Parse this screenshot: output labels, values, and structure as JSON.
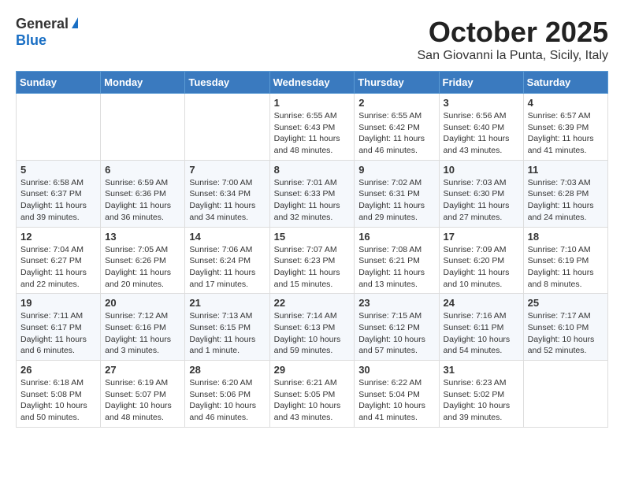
{
  "logo": {
    "general": "General",
    "blue": "Blue"
  },
  "title": "October 2025",
  "location": "San Giovanni la Punta, Sicily, Italy",
  "days_header": [
    "Sunday",
    "Monday",
    "Tuesday",
    "Wednesday",
    "Thursday",
    "Friday",
    "Saturday"
  ],
  "weeks": [
    [
      {
        "day": "",
        "content": ""
      },
      {
        "day": "",
        "content": ""
      },
      {
        "day": "",
        "content": ""
      },
      {
        "day": "1",
        "content": "Sunrise: 6:55 AM\nSunset: 6:43 PM\nDaylight: 11 hours\nand 48 minutes."
      },
      {
        "day": "2",
        "content": "Sunrise: 6:55 AM\nSunset: 6:42 PM\nDaylight: 11 hours\nand 46 minutes."
      },
      {
        "day": "3",
        "content": "Sunrise: 6:56 AM\nSunset: 6:40 PM\nDaylight: 11 hours\nand 43 minutes."
      },
      {
        "day": "4",
        "content": "Sunrise: 6:57 AM\nSunset: 6:39 PM\nDaylight: 11 hours\nand 41 minutes."
      }
    ],
    [
      {
        "day": "5",
        "content": "Sunrise: 6:58 AM\nSunset: 6:37 PM\nDaylight: 11 hours\nand 39 minutes."
      },
      {
        "day": "6",
        "content": "Sunrise: 6:59 AM\nSunset: 6:36 PM\nDaylight: 11 hours\nand 36 minutes."
      },
      {
        "day": "7",
        "content": "Sunrise: 7:00 AM\nSunset: 6:34 PM\nDaylight: 11 hours\nand 34 minutes."
      },
      {
        "day": "8",
        "content": "Sunrise: 7:01 AM\nSunset: 6:33 PM\nDaylight: 11 hours\nand 32 minutes."
      },
      {
        "day": "9",
        "content": "Sunrise: 7:02 AM\nSunset: 6:31 PM\nDaylight: 11 hours\nand 29 minutes."
      },
      {
        "day": "10",
        "content": "Sunrise: 7:03 AM\nSunset: 6:30 PM\nDaylight: 11 hours\nand 27 minutes."
      },
      {
        "day": "11",
        "content": "Sunrise: 7:03 AM\nSunset: 6:28 PM\nDaylight: 11 hours\nand 24 minutes."
      }
    ],
    [
      {
        "day": "12",
        "content": "Sunrise: 7:04 AM\nSunset: 6:27 PM\nDaylight: 11 hours\nand 22 minutes."
      },
      {
        "day": "13",
        "content": "Sunrise: 7:05 AM\nSunset: 6:26 PM\nDaylight: 11 hours\nand 20 minutes."
      },
      {
        "day": "14",
        "content": "Sunrise: 7:06 AM\nSunset: 6:24 PM\nDaylight: 11 hours\nand 17 minutes."
      },
      {
        "day": "15",
        "content": "Sunrise: 7:07 AM\nSunset: 6:23 PM\nDaylight: 11 hours\nand 15 minutes."
      },
      {
        "day": "16",
        "content": "Sunrise: 7:08 AM\nSunset: 6:21 PM\nDaylight: 11 hours\nand 13 minutes."
      },
      {
        "day": "17",
        "content": "Sunrise: 7:09 AM\nSunset: 6:20 PM\nDaylight: 11 hours\nand 10 minutes."
      },
      {
        "day": "18",
        "content": "Sunrise: 7:10 AM\nSunset: 6:19 PM\nDaylight: 11 hours\nand 8 minutes."
      }
    ],
    [
      {
        "day": "19",
        "content": "Sunrise: 7:11 AM\nSunset: 6:17 PM\nDaylight: 11 hours\nand 6 minutes."
      },
      {
        "day": "20",
        "content": "Sunrise: 7:12 AM\nSunset: 6:16 PM\nDaylight: 11 hours\nand 3 minutes."
      },
      {
        "day": "21",
        "content": "Sunrise: 7:13 AM\nSunset: 6:15 PM\nDaylight: 11 hours\nand 1 minute."
      },
      {
        "day": "22",
        "content": "Sunrise: 7:14 AM\nSunset: 6:13 PM\nDaylight: 10 hours\nand 59 minutes."
      },
      {
        "day": "23",
        "content": "Sunrise: 7:15 AM\nSunset: 6:12 PM\nDaylight: 10 hours\nand 57 minutes."
      },
      {
        "day": "24",
        "content": "Sunrise: 7:16 AM\nSunset: 6:11 PM\nDaylight: 10 hours\nand 54 minutes."
      },
      {
        "day": "25",
        "content": "Sunrise: 7:17 AM\nSunset: 6:10 PM\nDaylight: 10 hours\nand 52 minutes."
      }
    ],
    [
      {
        "day": "26",
        "content": "Sunrise: 6:18 AM\nSunset: 5:08 PM\nDaylight: 10 hours\nand 50 minutes."
      },
      {
        "day": "27",
        "content": "Sunrise: 6:19 AM\nSunset: 5:07 PM\nDaylight: 10 hours\nand 48 minutes."
      },
      {
        "day": "28",
        "content": "Sunrise: 6:20 AM\nSunset: 5:06 PM\nDaylight: 10 hours\nand 46 minutes."
      },
      {
        "day": "29",
        "content": "Sunrise: 6:21 AM\nSunset: 5:05 PM\nDaylight: 10 hours\nand 43 minutes."
      },
      {
        "day": "30",
        "content": "Sunrise: 6:22 AM\nSunset: 5:04 PM\nDaylight: 10 hours\nand 41 minutes."
      },
      {
        "day": "31",
        "content": "Sunrise: 6:23 AM\nSunset: 5:02 PM\nDaylight: 10 hours\nand 39 minutes."
      },
      {
        "day": "",
        "content": ""
      }
    ]
  ]
}
